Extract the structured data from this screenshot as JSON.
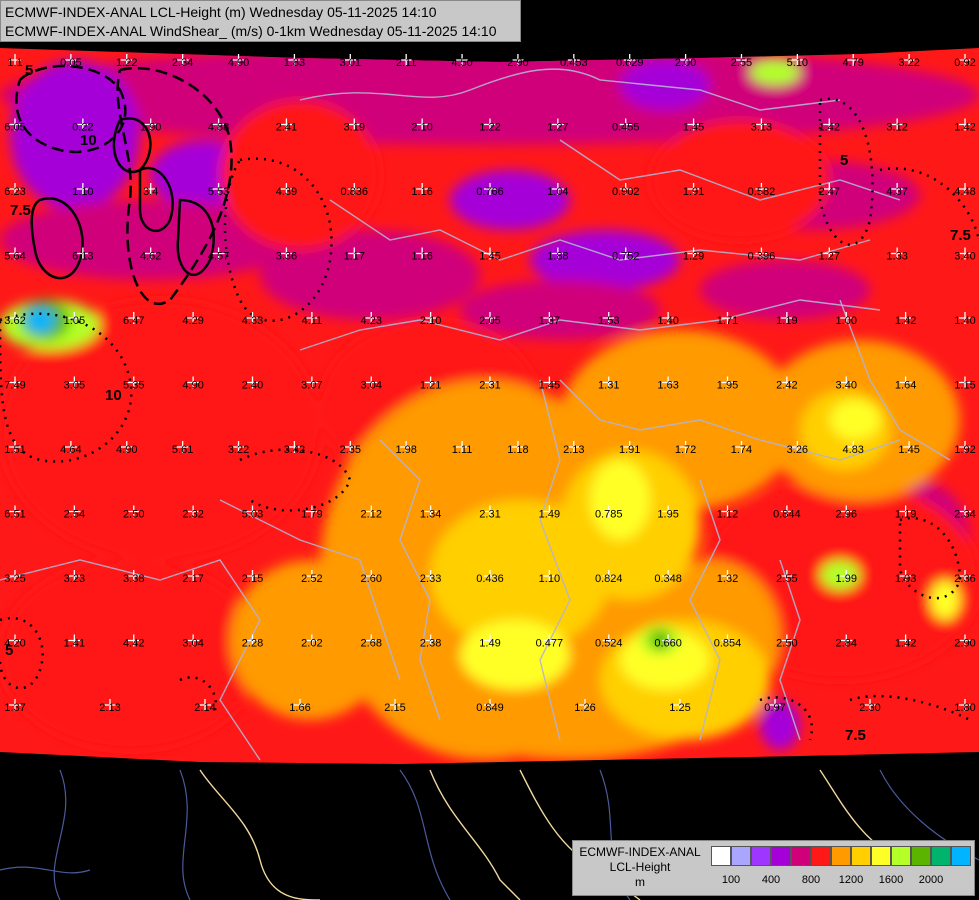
{
  "header": {
    "line1": "ECMWF-INDEX-ANAL LCL-Height (m) Wednesday 05-11-2025 14:10",
    "line2": "ECMWF-INDEX-ANAL WindShear_ (m/s) 0-1km Wednesday 05-11-2025 14:10"
  },
  "legend": {
    "model": "ECMWF-INDEX-ANAL",
    "variable": "LCL-Height",
    "unit": "m",
    "colors": [
      "#ffffff",
      "#aaa6ff",
      "#9f36ff",
      "#a600d8",
      "#d0007a",
      "#ff1818",
      "#ff9a00",
      "#ffcf00",
      "#ffff28",
      "#b4ff28",
      "#5ab400",
      "#00b46e",
      "#00b4ff"
    ],
    "tick_labels": [
      "100",
      "400",
      "800",
      "1200",
      "1600",
      "2000"
    ]
  },
  "map": {
    "fill_colors": {
      "purple": "#a600d8",
      "magenta": "#d0007a",
      "red": "#ff1818",
      "orange": "#ff9a00",
      "gold": "#ffcf00",
      "yellow": "#ffff28",
      "lime": "#b4ff28",
      "green": "#5ab400",
      "cyan": "#00b4ff",
      "violet": "#aaa6ff",
      "border": "#f0d8a0",
      "country": "#b4b4d2"
    },
    "station_values": [
      [
        "1.1",
        "0.05",
        "1.22",
        "2.34",
        "4.90",
        "1.83",
        "3.01",
        "2.11",
        "4.50",
        "2.90",
        "0.453",
        "0.629",
        "2.00",
        "2.55",
        "5.10",
        "4.79",
        "3.22",
        "0.92"
      ],
      [
        "6.05",
        "0.22",
        "1.90",
        "4.88",
        "2.41",
        "3.19",
        "2.10",
        "1.22",
        "1.27",
        "0.455",
        "1.45",
        "3.13",
        "1.42",
        "3.12",
        "1.42"
      ],
      [
        "6.23",
        "1.10",
        "3.4",
        "5.53",
        "4.39",
        "0.836",
        "1.16",
        "0.766",
        "1.04",
        "0.902",
        "1.91",
        "0.582",
        "2.47",
        "4.37",
        "4.48"
      ],
      [
        "5.64",
        "6.13",
        "4.62",
        "4.57",
        "3.36",
        "1.17",
        "1.16",
        "1.45",
        "1.88",
        "0.752",
        "1.29",
        "0.396",
        "1.27",
        "1.33",
        "3.40"
      ],
      [
        "3.62",
        "1.05",
        "6.47",
        "4.29",
        "4.33",
        "4.11",
        "4.23",
        "2.10",
        "2.05",
        "1.37",
        "1.53",
        "1.40",
        "1.71",
        "1.19",
        "1.00",
        "1.42",
        "1.40"
      ],
      [
        "7.49",
        "3.05",
        "5.35",
        "4.90",
        "2.40",
        "3.07",
        "3.04",
        "1.21",
        "2.31",
        "1.45",
        "1.31",
        "1.63",
        "1.95",
        "2.42",
        "3.40",
        "1.64",
        "1.15"
      ],
      [
        "1.51",
        "4.64",
        "4.90",
        "5.61",
        "3.22",
        "3.42",
        "2.35",
        "1.98",
        "1.11",
        "1.18",
        "2.13",
        "1.91",
        "1.72",
        "1.74",
        "3.26",
        "4.83",
        "1.45",
        "1.92"
      ],
      [
        "6.51",
        "2.54",
        "2.50",
        "2.32",
        "5.03",
        "1.79",
        "2.12",
        "1.34",
        "2.31",
        "1.49",
        "0.785",
        "1.95",
        "1.12",
        "0.844",
        "2.96",
        "1.19",
        "2.34"
      ],
      [
        "3.25",
        "3.23",
        "3.38",
        "2.17",
        "2.15",
        "2.52",
        "2.60",
        "2.33",
        "0.436",
        "1.10",
        "0.824",
        "0.348",
        "1.32",
        "2.55",
        "1.99",
        "1.93",
        "2.36"
      ],
      [
        "4.20",
        "1.41",
        "4.42",
        "3.04",
        "2.28",
        "2.02",
        "2.68",
        "2.38",
        "1.49",
        "0.477",
        "0.524",
        "0.660",
        "0.854",
        "2.50",
        "2.84",
        "1.42",
        "2.90"
      ],
      [
        "1.37",
        "2.13",
        "2.14",
        "1.66",
        "2.15",
        "0.849",
        "1.26",
        "1.25",
        "0.97",
        "2.30",
        "1.80"
      ]
    ],
    "shear_contour_labels": [
      "5",
      "7.5",
      "10"
    ]
  }
}
